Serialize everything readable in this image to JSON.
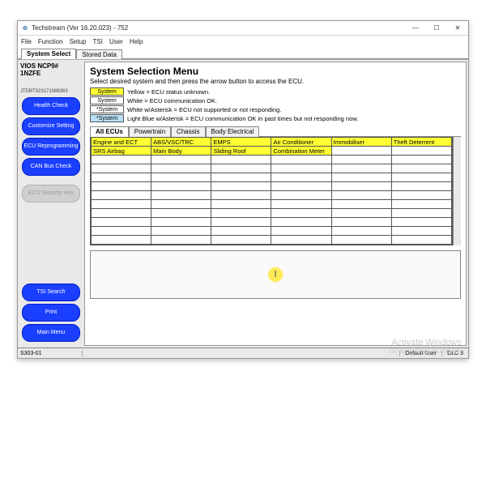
{
  "window": {
    "title": "Techstream (Ver 16.20.023) - 752",
    "min": "—",
    "max": "☐",
    "close": "✕"
  },
  "menu": [
    "File",
    "Function",
    "Setup",
    "TSI",
    "User",
    "Help"
  ],
  "top_tabs": [
    "System Select",
    "Stored Data"
  ],
  "vehicle": {
    "model": "VIOS NCP9#",
    "engine": "1NZFE",
    "vin": "JTDBT923171088363"
  },
  "side_buttons": {
    "health": "Health Check",
    "customize": "Customize Setting",
    "reprog": "ECU Reprogramming",
    "can": "CAN Bus Check",
    "seckey": "ECU Security Key",
    "tsi": "TSI Search",
    "print": "Print",
    "mainmenu": "Main Menu"
  },
  "main": {
    "title": "System Selection Menu",
    "sub": "Select desired system and then press the arrow button to access the ECU.",
    "legend": [
      {
        "label": "System",
        "cls": "yellow",
        "text": "Yellow = ECU status unknown."
      },
      {
        "label": "System",
        "cls": "white",
        "text": "White = ECU communication OK."
      },
      {
        "label": "*System",
        "cls": "white",
        "text": "White w/Asterisk = ECU not supported or not responding."
      },
      {
        "label": "*System",
        "cls": "lblue",
        "text": "Light Blue w/Asterisk = ECU communication OK in past times but not responding now."
      }
    ],
    "subtabs": [
      "All ECUs",
      "Powertrain",
      "Chassis",
      "Body Electrical"
    ],
    "grid_rows": [
      [
        "Engine and ECT",
        "ABS/VSC/TRC",
        "EMPS",
        "Air Conditioner",
        "Immobiliser",
        "Theft Deterrent"
      ],
      [
        "SRS Airbag",
        "Main Body",
        "Sliding Roof",
        "Combination Meter",
        "",
        ""
      ]
    ]
  },
  "status": {
    "left": "S303-01",
    "user": "Default User",
    "dlc": "DLC 3"
  },
  "activate": {
    "l1": "Activate Windows",
    "l2": "Go to Settings to activate"
  }
}
